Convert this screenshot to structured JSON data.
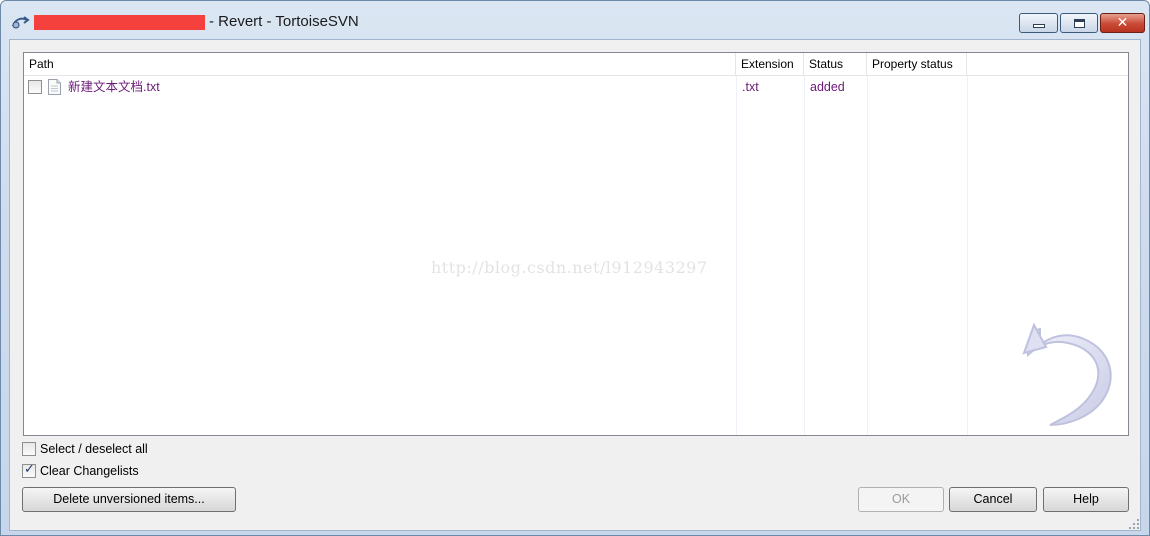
{
  "window": {
    "title": "- Revert - TortoiseSVN",
    "controls": {
      "minimize": "minimize",
      "maximize": "maximize",
      "close": "✕"
    }
  },
  "list": {
    "columns": [
      "Path",
      "Extension",
      "Status",
      "Property status"
    ],
    "rows": [
      {
        "checked": false,
        "path": "新建文本文档.txt",
        "extension": ".txt",
        "status": "added",
        "property_status": ""
      }
    ]
  },
  "watermark": "http://blog.csdn.net/l912943297",
  "options": {
    "select_all": {
      "label": "Select / deselect all",
      "checked": false
    },
    "clear_changelists": {
      "label": "Clear Changelists",
      "checked": true
    }
  },
  "buttons": {
    "delete_unversioned": "Delete unversioned items...",
    "ok": "OK",
    "cancel": "Cancel",
    "help": "Help"
  },
  "colors": {
    "item_text": "#6b1a78",
    "close_button": "#c94a36",
    "redaction": "#f5413e"
  },
  "icons": {
    "app": "tortoisesvn-revert-icon",
    "file": "text-file-icon",
    "logo": "revert-arrow-icon"
  }
}
